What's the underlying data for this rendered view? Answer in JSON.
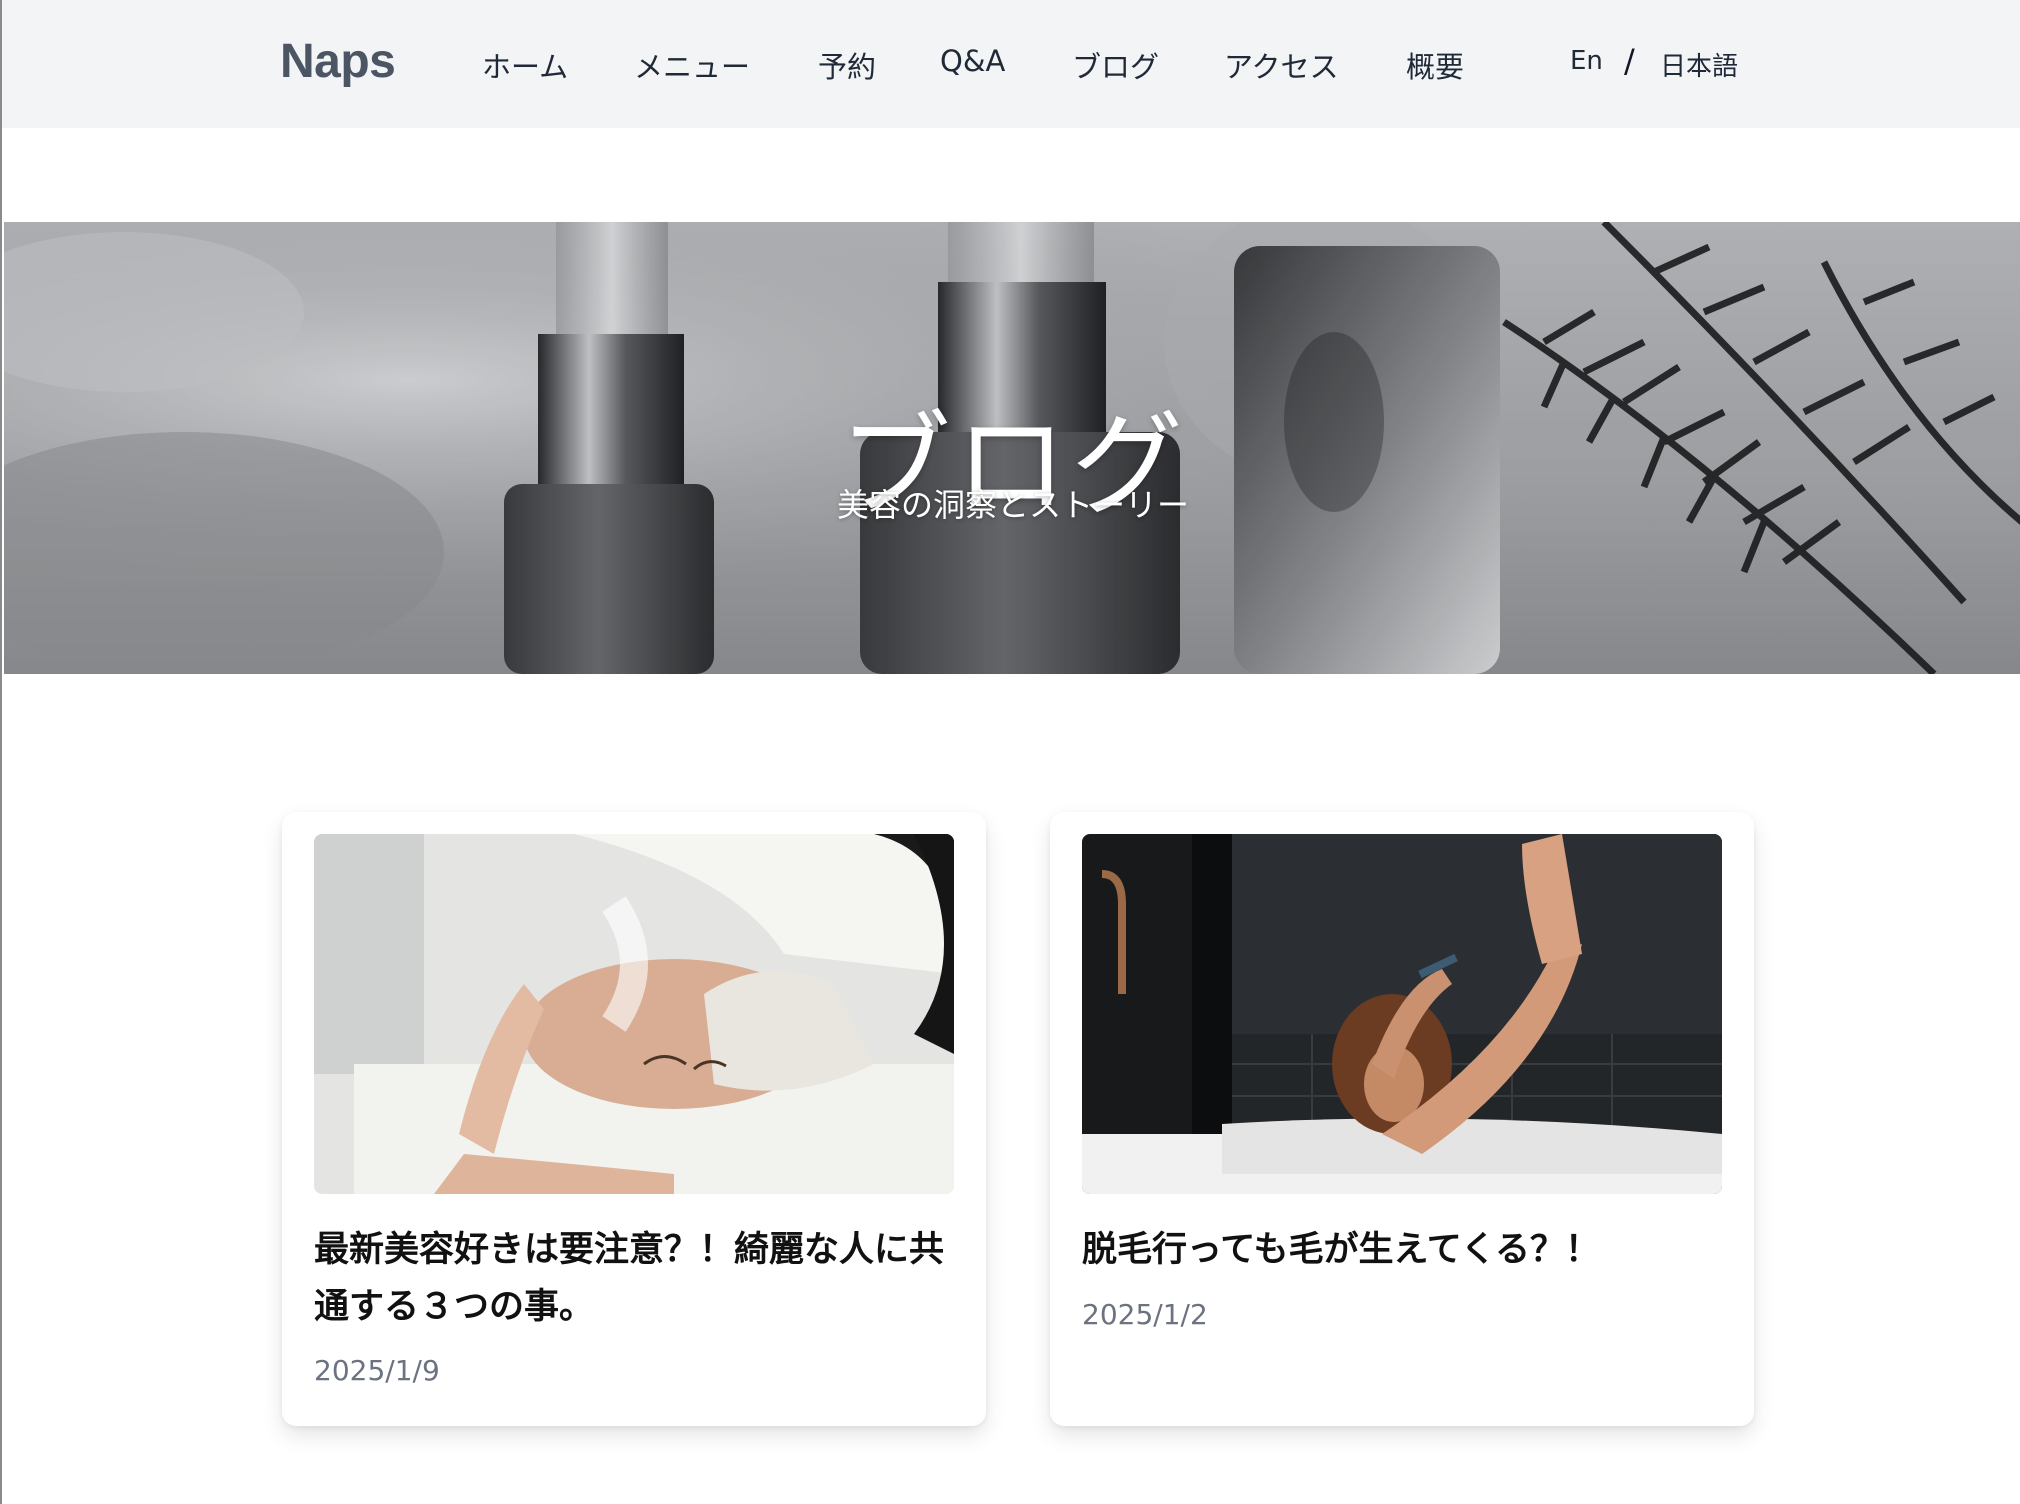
{
  "header": {
    "logo": "Naps",
    "nav": [
      {
        "label": "ホーム"
      },
      {
        "label": "メニュー"
      },
      {
        "label": "予約"
      },
      {
        "label": "Q&A"
      },
      {
        "label": "ブログ"
      },
      {
        "label": "アクセス"
      },
      {
        "label": "概要"
      }
    ],
    "language": {
      "english": "En",
      "separator": "/",
      "japanese": "日本語"
    }
  },
  "hero": {
    "title": "ブログ",
    "subtitle": "美容の洞察とストーリー"
  },
  "posts": [
    {
      "title": "最新美容好きは要注意？！綺麗な人に共通する３つの事。",
      "date": "2025/1/9",
      "image": "facial-treatment-photo"
    },
    {
      "title": "脱毛行っても毛が生えてくる？！",
      "date": "2025/1/2",
      "image": "bathtub-shaving-photo"
    }
  ],
  "colors": {
    "header_bg": "#f3f4f6",
    "logo": "#4b5563",
    "date_text": "#6b7280"
  }
}
